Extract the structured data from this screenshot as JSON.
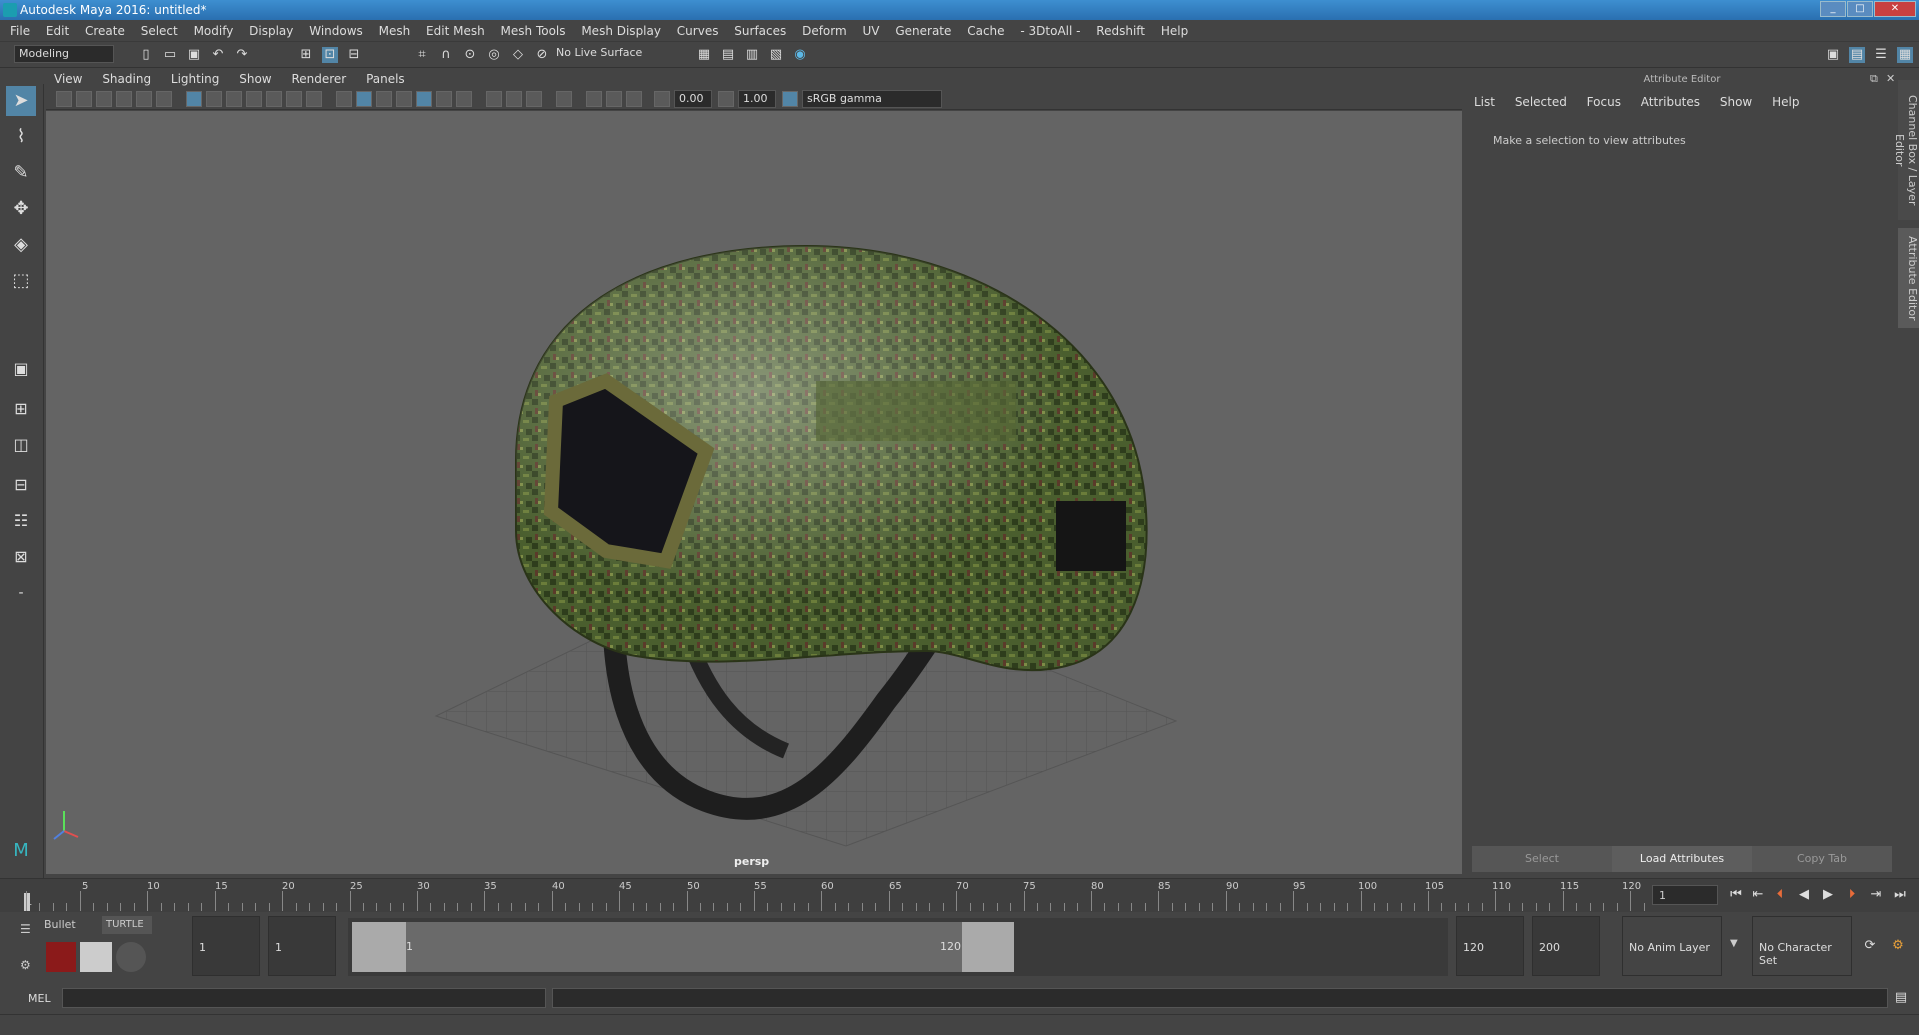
{
  "window": {
    "title": "Autodesk Maya 2016: untitled*",
    "min": "_",
    "max": "□",
    "close": "✕"
  },
  "menus": [
    "File",
    "Edit",
    "Create",
    "Select",
    "Modify",
    "Display",
    "Windows",
    "Mesh",
    "Edit Mesh",
    "Mesh Tools",
    "Mesh Display",
    "Curves",
    "Surfaces",
    "Deform",
    "UV",
    "Generate",
    "Cache",
    "- 3DtoAll -",
    "Redshift",
    "Help"
  ],
  "shelf": {
    "mode": "Modeling",
    "live_surface": "No Live Surface"
  },
  "viewport": {
    "menus": [
      "View",
      "Shading",
      "Lighting",
      "Show",
      "Renderer",
      "Panels"
    ],
    "exposure": "0.00",
    "gamma": "1.00",
    "colorspace": "sRGB gamma",
    "camera_label": "persp"
  },
  "attribute_editor": {
    "title": "Attribute Editor",
    "menus": [
      "List",
      "Selected",
      "Focus",
      "Attributes",
      "Show",
      "Help"
    ],
    "message": "Make a selection to view attributes",
    "buttons": {
      "select": "Select",
      "load": "Load Attributes",
      "copy": "Copy Tab"
    },
    "side_tabs": [
      "Channel Box / Layer Editor",
      "Attribute Editor"
    ]
  },
  "timeline": {
    "ticks": [
      "1",
      "5",
      "10",
      "15",
      "20",
      "25",
      "30",
      "35",
      "40",
      "45",
      "50",
      "55",
      "60",
      "65",
      "70",
      "75",
      "80",
      "85",
      "90",
      "95",
      "100",
      "105",
      "110",
      "115",
      "120"
    ],
    "current_frame": "1"
  },
  "range": {
    "shelf_tabs": [
      "Bullet",
      "TURTLE"
    ],
    "start_time": "1",
    "start_playback": "1",
    "slider_start": "1",
    "slider_end": "120",
    "end_playback": "120",
    "end_time": "200",
    "anim_layer": "No Anim Layer",
    "character_set": "No Character Set"
  },
  "cmdline": {
    "label": "MEL"
  },
  "colors": {
    "accent": "#5285a6",
    "title_bar": "#2a6fb0",
    "viewport_bg": "#646464"
  }
}
